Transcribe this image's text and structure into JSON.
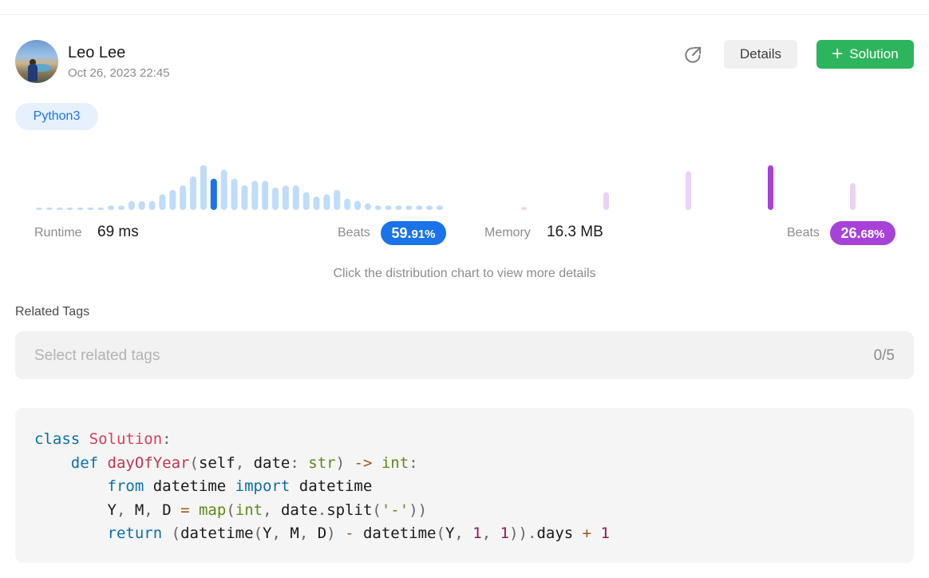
{
  "user": {
    "name": "Leo Lee",
    "date": "Oct 26, 2023 22:45"
  },
  "actions": {
    "details_label": "Details",
    "solution_label": "Solution"
  },
  "language": "Python3",
  "runtime": {
    "label": "Runtime",
    "value": "69 ms",
    "beats_label": "Beats",
    "beats_int": "59.",
    "beats_dec": "91%",
    "color": "#1a73e8",
    "distribution": [
      1,
      1,
      1,
      1,
      1,
      1,
      1,
      2,
      2,
      4,
      4,
      4,
      7,
      9,
      11,
      15,
      20,
      14,
      18,
      14,
      11,
      13,
      13,
      10,
      11,
      11,
      8,
      6,
      7,
      9,
      5,
      4,
      3,
      2,
      2,
      2,
      2,
      2,
      2,
      2
    ],
    "highlight_index": 17
  },
  "memory": {
    "label": "Memory",
    "value": "16.3 MB",
    "beats_label": "Beats",
    "beats_int": "26.",
    "beats_dec": "68%",
    "color": "#a742d9",
    "distribution": [
      1,
      6,
      13,
      15,
      9
    ],
    "highlight_index": 3
  },
  "hint": "Click the distribution chart to view more details",
  "tags": {
    "title": "Related Tags",
    "placeholder": "Select related tags",
    "count": "0/5"
  },
  "code": {
    "language": "python",
    "lines": [
      "class Solution:",
      "    def dayOfYear(self, date: str) -> int:",
      "        from datetime import datetime",
      "        Y, M, D = map(int, date.split('-'))",
      "        return (datetime(Y, M, D) - datetime(Y, 1, 1)).days + 1"
    ]
  },
  "icons": {
    "share": "share-icon",
    "plus": "plus-icon"
  }
}
